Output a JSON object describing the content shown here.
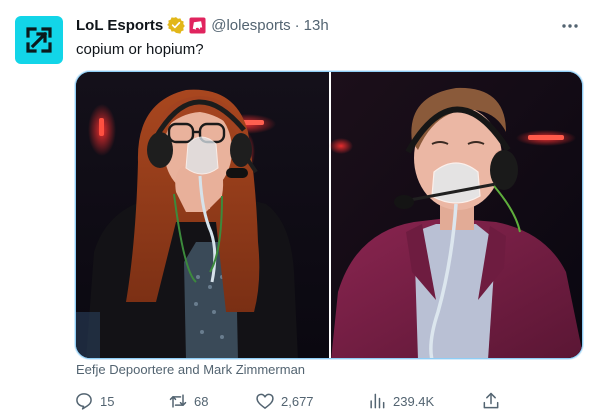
{
  "tweet": {
    "author_name": "LoL Esports",
    "handle": "@lolesports",
    "separator": "·",
    "time": "13h",
    "text": "copium or hopium?",
    "media_caption": "Eefje Depoortere and Mark Zimmerman",
    "media_images": [
      {
        "icon": "woman-with-oxygen-mask-photo"
      },
      {
        "icon": "man-with-oxygen-mask-photo"
      }
    ]
  },
  "metrics": {
    "replies": "15",
    "reposts": "68",
    "likes": "2,677",
    "views": "239.4K"
  },
  "icons": {
    "avatar": "lol-esports-logo",
    "verified": "gold-verified-badge",
    "affiliate": "riot-games-affiliate-badge",
    "more": "more-options-icon",
    "reply": "reply-icon",
    "repost": "repost-icon",
    "like": "heart-icon",
    "views": "views-chart-icon",
    "share": "share-icon"
  },
  "colors": {
    "brand_cyan": "#12d5e8",
    "verified_gold": "#e2b719",
    "affiliate_red": "#e0245e",
    "muted_text": "#536471",
    "media_border": "#8ecdf5"
  }
}
